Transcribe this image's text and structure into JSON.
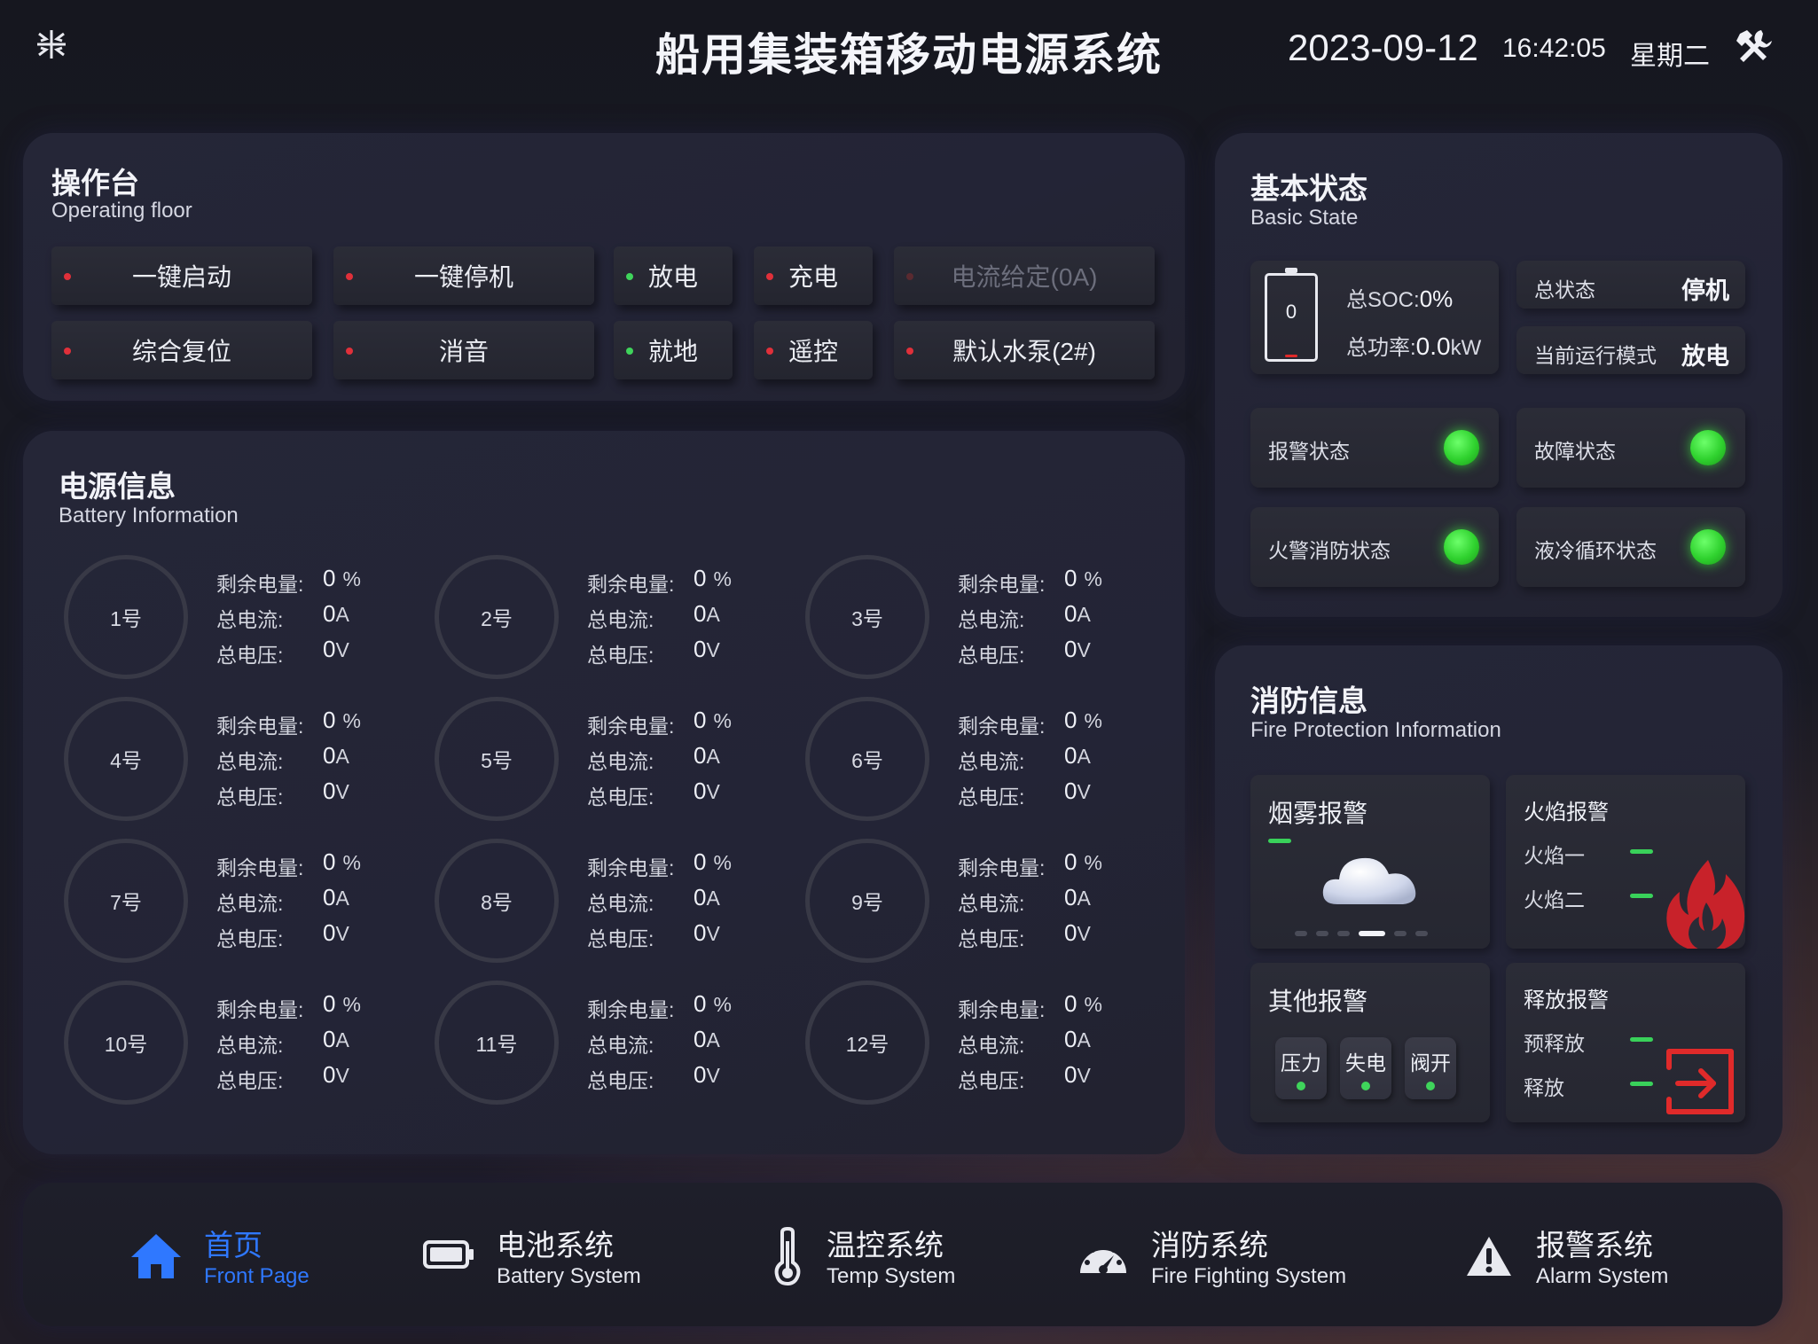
{
  "header": {
    "title": "船用集装箱移动电源系统",
    "date": "2023-09-12",
    "time": "16:42:05",
    "weekday": "星期二",
    "collapse_icon": "collapse-icon",
    "tools_icon": "tools-icon"
  },
  "operating_floor": {
    "title": "操作台",
    "subtitle": "Operating floor",
    "buttons": [
      {
        "label": "一键启动",
        "dot": "#e0303a"
      },
      {
        "label": "一键停机",
        "dot": "#e0303a"
      },
      {
        "label": "放电",
        "dot": "#3fd45b"
      },
      {
        "label": "充电",
        "dot": "#e0303a"
      },
      {
        "label": "电流给定(0A)",
        "dot": "#5a2a30"
      },
      {
        "label": "综合复位",
        "dot": "#e0303a"
      },
      {
        "label": "消音",
        "dot": "#e0303a"
      },
      {
        "label": "就地",
        "dot": "#3fd45b"
      },
      {
        "label": "遥控",
        "dot": "#e0303a"
      },
      {
        "label": "默认水泵(2#)",
        "dot": "#e0303a"
      }
    ]
  },
  "battery_info": {
    "title": "电源信息",
    "subtitle": "Battery Information",
    "labels": {
      "soc": "剩余电量:",
      "current": "总电流:",
      "voltage": "总电压:"
    },
    "units": {
      "soc": "%",
      "current": "A",
      "voltage": "V"
    },
    "packs": [
      {
        "name": "1号",
        "soc": "0",
        "current": "0",
        "voltage": "0"
      },
      {
        "name": "2号",
        "soc": "0",
        "current": "0",
        "voltage": "0"
      },
      {
        "name": "3号",
        "soc": "0",
        "current": "0",
        "voltage": "0"
      },
      {
        "name": "4号",
        "soc": "0",
        "current": "0",
        "voltage": "0"
      },
      {
        "name": "5号",
        "soc": "0",
        "current": "0",
        "voltage": "0"
      },
      {
        "name": "6号",
        "soc": "0",
        "current": "0",
        "voltage": "0"
      },
      {
        "name": "7号",
        "soc": "0",
        "current": "0",
        "voltage": "0"
      },
      {
        "name": "8号",
        "soc": "0",
        "current": "0",
        "voltage": "0"
      },
      {
        "name": "9号",
        "soc": "0",
        "current": "0",
        "voltage": "0"
      },
      {
        "name": "10号",
        "soc": "0",
        "current": "0",
        "voltage": "0"
      },
      {
        "name": "11号",
        "soc": "0",
        "current": "0",
        "voltage": "0"
      },
      {
        "name": "12号",
        "soc": "0",
        "current": "0",
        "voltage": "0"
      }
    ]
  },
  "basic_state": {
    "title": "基本状态",
    "subtitle": "Basic State",
    "battery_gauge_value": "0",
    "soc_label": "总SOC:",
    "soc_value": "0%",
    "power_label": "总功率:",
    "power_value": "0.0",
    "power_unit": "kW",
    "total_state_label": "总状态",
    "total_state_value": "停机",
    "mode_label": "当前运行模式",
    "mode_value": "放电",
    "indicators": [
      {
        "label": "报警状态",
        "color": "#3fd45b"
      },
      {
        "label": "故障状态",
        "color": "#3fd45b"
      },
      {
        "label": "火警消防状态",
        "color": "#3fd45b"
      },
      {
        "label": "液冷循环状态",
        "color": "#3fd45b"
      }
    ]
  },
  "fire_info": {
    "title": "消防信息",
    "subtitle": "Fire Protection Information",
    "smoke_title": "烟雾报警",
    "smoke_icon": "cloud-icon",
    "flame_title": "火焰报警",
    "flame_items": [
      "火焰一",
      "火焰二"
    ],
    "flame_icon": "flame-icon",
    "other_title": "其他报警",
    "other_items": [
      "压力",
      "失电",
      "阀开"
    ],
    "release_title": "释放报警",
    "release_items": [
      "预释放",
      "释放"
    ],
    "release_icon": "release-icon",
    "ok_color": "#39d15a",
    "alarm_color": "#e02a2a"
  },
  "nav": {
    "items": [
      {
        "label": "首页",
        "sub": "Front Page",
        "icon": "home-icon"
      },
      {
        "label": "电池系统",
        "sub": "Battery System",
        "icon": "battery-icon"
      },
      {
        "label": "温控系统",
        "sub": "Temp System",
        "icon": "thermometer-icon"
      },
      {
        "label": "消防系统",
        "sub": "Fire Fighting System",
        "icon": "gauge-icon"
      },
      {
        "label": "报警系统",
        "sub": "Alarm System",
        "icon": "warning-icon"
      }
    ],
    "active_color": "#2f78ff"
  }
}
